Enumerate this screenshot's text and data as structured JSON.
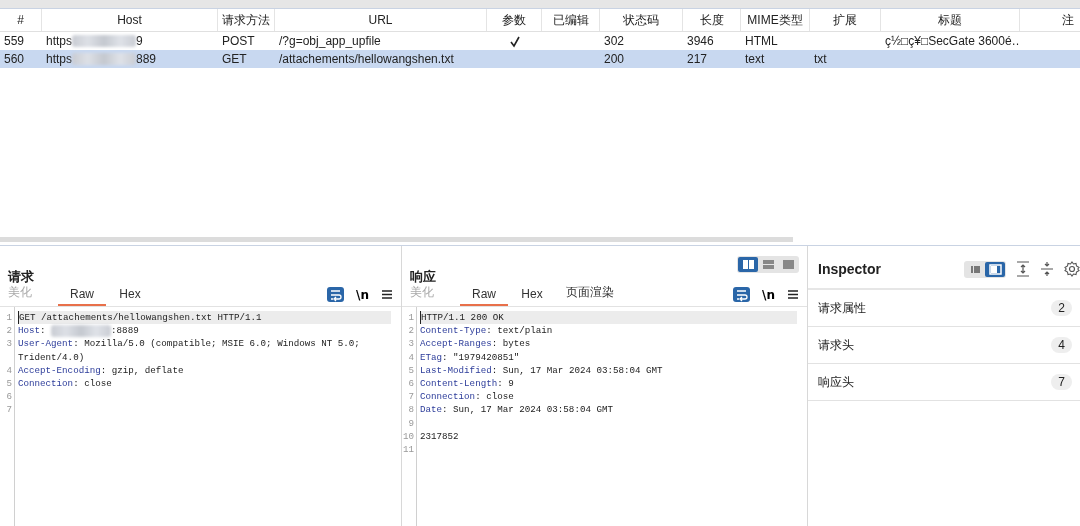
{
  "table": {
    "columns": [
      {
        "label": "#"
      },
      {
        "label": "Host"
      },
      {
        "label": "请求方法"
      },
      {
        "label": "URL"
      },
      {
        "label": "参数"
      },
      {
        "label": "已编辑"
      },
      {
        "label": "状态码"
      },
      {
        "label": "长度"
      },
      {
        "label": "MIME类型"
      },
      {
        "label": "扩展"
      },
      {
        "label": "标题"
      },
      {
        "label": "注"
      }
    ],
    "rows": [
      {
        "selected": false,
        "number": "559",
        "host": {
          "prefix": "https",
          "suffix": "9",
          "redacted": true
        },
        "method": "POST",
        "url": "/?g=obj_app_upfile",
        "params": true,
        "edited": false,
        "status": "302",
        "length": "3946",
        "mime": "HTML",
        "extension": "",
        "title": "ç½□ç¥□SecGate 3600é…"
      },
      {
        "selected": true,
        "number": "560",
        "host": {
          "prefix": "https",
          "suffix": "889",
          "redacted": true
        },
        "method": "GET",
        "url": "/attachements/hellowangshen.txt",
        "params": false,
        "edited": false,
        "status": "200",
        "length": "217",
        "mime": "text",
        "extension": "txt",
        "title": ""
      }
    ]
  },
  "request": {
    "title": "请求",
    "tabs": [
      {
        "label": "美化",
        "selected": false,
        "disabled": true
      },
      {
        "label": "Raw",
        "selected": true,
        "disabled": false
      },
      {
        "label": "Hex",
        "selected": false,
        "disabled": false
      }
    ],
    "newline_label": "\\n",
    "lines": [
      {
        "n": "1",
        "current": true,
        "parts": [
          {
            "kind": "plain",
            "text": "GET /attachements/hellowangshen.txt HTTP/1.1"
          }
        ]
      },
      {
        "n": "2",
        "current": false,
        "parts": [
          {
            "kind": "key",
            "text": "Host"
          },
          {
            "kind": "plain",
            "text": ": "
          },
          {
            "kind": "blur"
          },
          {
            "kind": "plain",
            "text": ":8889"
          }
        ]
      },
      {
        "n": "3",
        "current": false,
        "parts": [
          {
            "kind": "key",
            "text": "User-Agent"
          },
          {
            "kind": "plain",
            "text": ": Mozilla/5.0 (compatible; MSIE 6.0; Windows NT 5.0; Trident/4.0)"
          }
        ]
      },
      {
        "n": "4",
        "current": false,
        "parts": [
          {
            "kind": "key",
            "text": "Accept-Encoding"
          },
          {
            "kind": "plain",
            "text": ": gzip, deflate"
          }
        ]
      },
      {
        "n": "5",
        "current": false,
        "parts": [
          {
            "kind": "key",
            "text": "Connection"
          },
          {
            "kind": "plain",
            "text": ": close"
          }
        ]
      },
      {
        "n": "6",
        "current": false
      },
      {
        "n": "7",
        "current": false
      }
    ]
  },
  "response": {
    "title": "响应",
    "layout_toggle": [
      {
        "selected": true
      },
      {
        "selected": false
      },
      {
        "selected": false
      }
    ],
    "tabs": [
      {
        "label": "美化",
        "selected": false,
        "disabled": true
      },
      {
        "label": "Raw",
        "selected": true,
        "disabled": false
      },
      {
        "label": "Hex",
        "selected": false,
        "disabled": false
      },
      {
        "label": "页面渲染",
        "selected": false,
        "disabled": false
      }
    ],
    "newline_label": "\\n",
    "lines": [
      {
        "n": "1",
        "current": true,
        "parts": [
          {
            "kind": "plain",
            "text": "HTTP/1.1 200 OK"
          }
        ]
      },
      {
        "n": "2",
        "current": false,
        "parts": [
          {
            "kind": "key",
            "text": "Content-Type"
          },
          {
            "kind": "plain",
            "text": ": text/plain"
          }
        ]
      },
      {
        "n": "3",
        "current": false,
        "parts": [
          {
            "kind": "key",
            "text": "Accept-Ranges"
          },
          {
            "kind": "plain",
            "text": ": bytes"
          }
        ]
      },
      {
        "n": "4",
        "current": false,
        "parts": [
          {
            "kind": "key",
            "text": "ETag"
          },
          {
            "kind": "plain",
            "text": ": \"1979420851\""
          }
        ]
      },
      {
        "n": "5",
        "current": false,
        "parts": [
          {
            "kind": "key",
            "text": "Last-Modified"
          },
          {
            "kind": "plain",
            "text": ": Sun, 17 Mar 2024 03:58:04 GMT"
          }
        ]
      },
      {
        "n": "6",
        "current": false,
        "parts": [
          {
            "kind": "key",
            "text": "Content-Length"
          },
          {
            "kind": "plain",
            "text": ": 9"
          }
        ]
      },
      {
        "n": "7",
        "current": false,
        "parts": [
          {
            "kind": "key",
            "text": "Connection"
          },
          {
            "kind": "plain",
            "text": ": close"
          }
        ]
      },
      {
        "n": "8",
        "current": false,
        "parts": [
          {
            "kind": "key",
            "text": "Date"
          },
          {
            "kind": "plain",
            "text": ": Sun, 17 Mar 2024 03:58:04 GMT"
          }
        ]
      },
      {
        "n": "9",
        "current": false
      },
      {
        "n": "10",
        "current": false,
        "parts": [
          {
            "kind": "plain",
            "text": "2317852"
          }
        ]
      },
      {
        "n": "11",
        "current": false
      }
    ]
  },
  "inspector": {
    "title": "Inspector",
    "view_toggle": [
      {
        "selected": false
      },
      {
        "selected": true
      }
    ],
    "sections": [
      {
        "label": "请求属性",
        "count": "2"
      },
      {
        "label": "请求头",
        "count": "4"
      },
      {
        "label": "响应头",
        "count": "7"
      }
    ]
  }
}
